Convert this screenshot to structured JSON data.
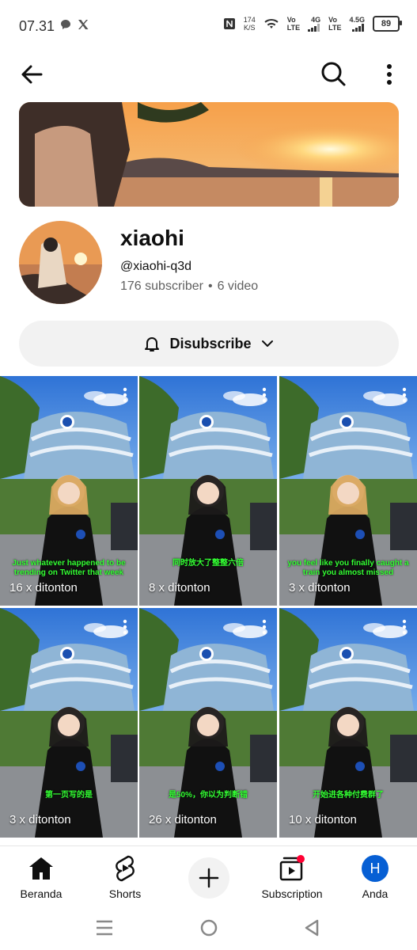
{
  "status_bar": {
    "time": "07.31",
    "net_speed_value": "174",
    "net_speed_unit": "K/S",
    "sim1_label_top": "Vo",
    "sim1_label_bottom": "LTE",
    "sim1_net": "4G",
    "sim2_label_top": "Vo",
    "sim2_label_bottom": "LTE",
    "sim2_net": "4.5G",
    "battery": "89"
  },
  "app_bar": {
    "back_icon": "arrow-left-icon",
    "search_icon": "search-icon",
    "more_icon": "more-vertical-icon"
  },
  "channel": {
    "name": "xiaohi",
    "handle": "@xiaohi-q3d",
    "subscribers": "176 subscriber",
    "separator": "•",
    "videos": "6 video"
  },
  "subscribe_button": {
    "label": "Disubscribe",
    "bell_icon": "bell-icon",
    "chevron_icon": "chevron-down-icon"
  },
  "shorts": [
    {
      "views": "16 x ditonton",
      "caption": "Just whatever happened to be trending on Twitter that week"
    },
    {
      "views": "8 x ditonton",
      "caption": "同时放大了整整六倍"
    },
    {
      "views": "3 x ditonton",
      "caption": "you feel like you finally caught a train you almost missed"
    },
    {
      "views": "3 x ditonton",
      "caption": "第一页写的是"
    },
    {
      "views": "26 x ditonton",
      "caption": "是50%，你以为判断错"
    },
    {
      "views": "10 x ditonton",
      "caption": "开始进各种付费群了"
    }
  ],
  "bottom_nav": {
    "home": "Beranda",
    "shorts": "Shorts",
    "subscriptions": "Subscription",
    "you": "Anda",
    "you_avatar_letter": "H"
  },
  "colors": {
    "accent_blue": "#065fd4",
    "caption_green": "#33ff33",
    "notification_red": "#ff0033"
  }
}
